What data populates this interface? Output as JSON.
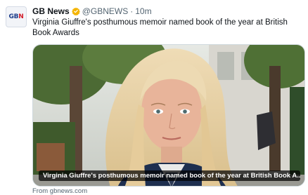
{
  "tweet": {
    "author_name": "GB News",
    "verified": true,
    "handle": "@GBNEWS",
    "separator": "·",
    "time": "10m",
    "text": "Virginia Giuffre's posthumous memoir named book of the year at British Book Awards",
    "avatar_logo": "GBN"
  },
  "card": {
    "caption": "Virginia Giuffre's posthumous memoir named book of the year at British Book A...",
    "source": "From gbnews.com"
  },
  "colors": {
    "verified_badge": "#f4b400",
    "logo_blue": "#1d3d8a",
    "logo_red": "#d21e2b"
  }
}
